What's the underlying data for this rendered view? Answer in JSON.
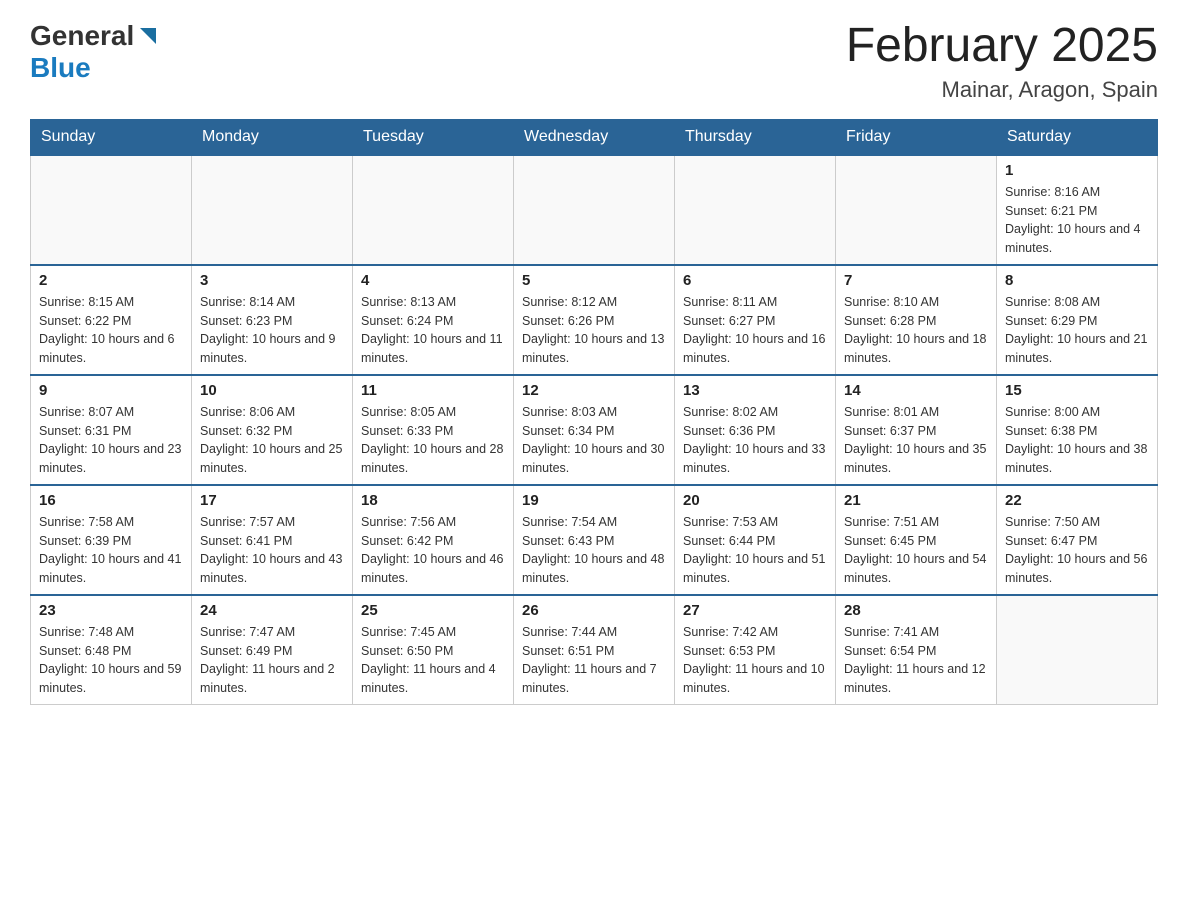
{
  "header": {
    "logo_general": "General",
    "logo_blue": "Blue",
    "month_title": "February 2025",
    "location": "Mainar, Aragon, Spain"
  },
  "weekdays": [
    "Sunday",
    "Monday",
    "Tuesday",
    "Wednesday",
    "Thursday",
    "Friday",
    "Saturday"
  ],
  "weeks": [
    [
      {
        "day": "",
        "sunrise": "",
        "sunset": "",
        "daylight": ""
      },
      {
        "day": "",
        "sunrise": "",
        "sunset": "",
        "daylight": ""
      },
      {
        "day": "",
        "sunrise": "",
        "sunset": "",
        "daylight": ""
      },
      {
        "day": "",
        "sunrise": "",
        "sunset": "",
        "daylight": ""
      },
      {
        "day": "",
        "sunrise": "",
        "sunset": "",
        "daylight": ""
      },
      {
        "day": "",
        "sunrise": "",
        "sunset": "",
        "daylight": ""
      },
      {
        "day": "1",
        "sunrise": "Sunrise: 8:16 AM",
        "sunset": "Sunset: 6:21 PM",
        "daylight": "Daylight: 10 hours and 4 minutes."
      }
    ],
    [
      {
        "day": "2",
        "sunrise": "Sunrise: 8:15 AM",
        "sunset": "Sunset: 6:22 PM",
        "daylight": "Daylight: 10 hours and 6 minutes."
      },
      {
        "day": "3",
        "sunrise": "Sunrise: 8:14 AM",
        "sunset": "Sunset: 6:23 PM",
        "daylight": "Daylight: 10 hours and 9 minutes."
      },
      {
        "day": "4",
        "sunrise": "Sunrise: 8:13 AM",
        "sunset": "Sunset: 6:24 PM",
        "daylight": "Daylight: 10 hours and 11 minutes."
      },
      {
        "day": "5",
        "sunrise": "Sunrise: 8:12 AM",
        "sunset": "Sunset: 6:26 PM",
        "daylight": "Daylight: 10 hours and 13 minutes."
      },
      {
        "day": "6",
        "sunrise": "Sunrise: 8:11 AM",
        "sunset": "Sunset: 6:27 PM",
        "daylight": "Daylight: 10 hours and 16 minutes."
      },
      {
        "day": "7",
        "sunrise": "Sunrise: 8:10 AM",
        "sunset": "Sunset: 6:28 PM",
        "daylight": "Daylight: 10 hours and 18 minutes."
      },
      {
        "day": "8",
        "sunrise": "Sunrise: 8:08 AM",
        "sunset": "Sunset: 6:29 PM",
        "daylight": "Daylight: 10 hours and 21 minutes."
      }
    ],
    [
      {
        "day": "9",
        "sunrise": "Sunrise: 8:07 AM",
        "sunset": "Sunset: 6:31 PM",
        "daylight": "Daylight: 10 hours and 23 minutes."
      },
      {
        "day": "10",
        "sunrise": "Sunrise: 8:06 AM",
        "sunset": "Sunset: 6:32 PM",
        "daylight": "Daylight: 10 hours and 25 minutes."
      },
      {
        "day": "11",
        "sunrise": "Sunrise: 8:05 AM",
        "sunset": "Sunset: 6:33 PM",
        "daylight": "Daylight: 10 hours and 28 minutes."
      },
      {
        "day": "12",
        "sunrise": "Sunrise: 8:03 AM",
        "sunset": "Sunset: 6:34 PM",
        "daylight": "Daylight: 10 hours and 30 minutes."
      },
      {
        "day": "13",
        "sunrise": "Sunrise: 8:02 AM",
        "sunset": "Sunset: 6:36 PM",
        "daylight": "Daylight: 10 hours and 33 minutes."
      },
      {
        "day": "14",
        "sunrise": "Sunrise: 8:01 AM",
        "sunset": "Sunset: 6:37 PM",
        "daylight": "Daylight: 10 hours and 35 minutes."
      },
      {
        "day": "15",
        "sunrise": "Sunrise: 8:00 AM",
        "sunset": "Sunset: 6:38 PM",
        "daylight": "Daylight: 10 hours and 38 minutes."
      }
    ],
    [
      {
        "day": "16",
        "sunrise": "Sunrise: 7:58 AM",
        "sunset": "Sunset: 6:39 PM",
        "daylight": "Daylight: 10 hours and 41 minutes."
      },
      {
        "day": "17",
        "sunrise": "Sunrise: 7:57 AM",
        "sunset": "Sunset: 6:41 PM",
        "daylight": "Daylight: 10 hours and 43 minutes."
      },
      {
        "day": "18",
        "sunrise": "Sunrise: 7:56 AM",
        "sunset": "Sunset: 6:42 PM",
        "daylight": "Daylight: 10 hours and 46 minutes."
      },
      {
        "day": "19",
        "sunrise": "Sunrise: 7:54 AM",
        "sunset": "Sunset: 6:43 PM",
        "daylight": "Daylight: 10 hours and 48 minutes."
      },
      {
        "day": "20",
        "sunrise": "Sunrise: 7:53 AM",
        "sunset": "Sunset: 6:44 PM",
        "daylight": "Daylight: 10 hours and 51 minutes."
      },
      {
        "day": "21",
        "sunrise": "Sunrise: 7:51 AM",
        "sunset": "Sunset: 6:45 PM",
        "daylight": "Daylight: 10 hours and 54 minutes."
      },
      {
        "day": "22",
        "sunrise": "Sunrise: 7:50 AM",
        "sunset": "Sunset: 6:47 PM",
        "daylight": "Daylight: 10 hours and 56 minutes."
      }
    ],
    [
      {
        "day": "23",
        "sunrise": "Sunrise: 7:48 AM",
        "sunset": "Sunset: 6:48 PM",
        "daylight": "Daylight: 10 hours and 59 minutes."
      },
      {
        "day": "24",
        "sunrise": "Sunrise: 7:47 AM",
        "sunset": "Sunset: 6:49 PM",
        "daylight": "Daylight: 11 hours and 2 minutes."
      },
      {
        "day": "25",
        "sunrise": "Sunrise: 7:45 AM",
        "sunset": "Sunset: 6:50 PM",
        "daylight": "Daylight: 11 hours and 4 minutes."
      },
      {
        "day": "26",
        "sunrise": "Sunrise: 7:44 AM",
        "sunset": "Sunset: 6:51 PM",
        "daylight": "Daylight: 11 hours and 7 minutes."
      },
      {
        "day": "27",
        "sunrise": "Sunrise: 7:42 AM",
        "sunset": "Sunset: 6:53 PM",
        "daylight": "Daylight: 11 hours and 10 minutes."
      },
      {
        "day": "28",
        "sunrise": "Sunrise: 7:41 AM",
        "sunset": "Sunset: 6:54 PM",
        "daylight": "Daylight: 11 hours and 12 minutes."
      },
      {
        "day": "",
        "sunrise": "",
        "sunset": "",
        "daylight": ""
      }
    ]
  ]
}
